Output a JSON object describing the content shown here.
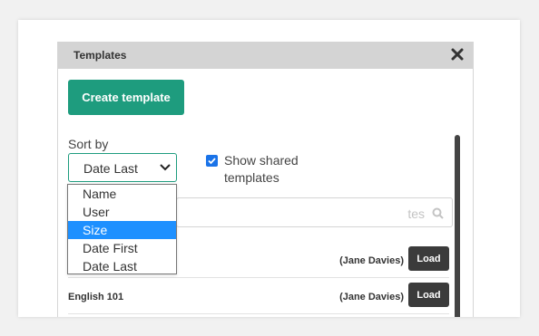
{
  "panel": {
    "title": "Templates",
    "close_icon": "close-icon"
  },
  "create_button_label": "Create template",
  "sort": {
    "label": "Sort by",
    "selected": "Date Last",
    "options": [
      "Name",
      "User",
      "Size",
      "Date First",
      "Date Last"
    ],
    "highlighted": "Size"
  },
  "shared": {
    "label": "Show shared templates",
    "checked": true
  },
  "search": {
    "placeholder_visible": "tes",
    "icon": "search-icon"
  },
  "rows": [
    {
      "name": "",
      "owner": "(Jane Davies)",
      "action": "Load"
    },
    {
      "name": "English 101",
      "owner": "(Jane Davies)",
      "action": "Load"
    }
  ],
  "colors": {
    "accent": "#1e9c7e",
    "header": "#d4d4d4",
    "load_button": "#3b3b3b",
    "selected_option": "#1e90ff"
  }
}
